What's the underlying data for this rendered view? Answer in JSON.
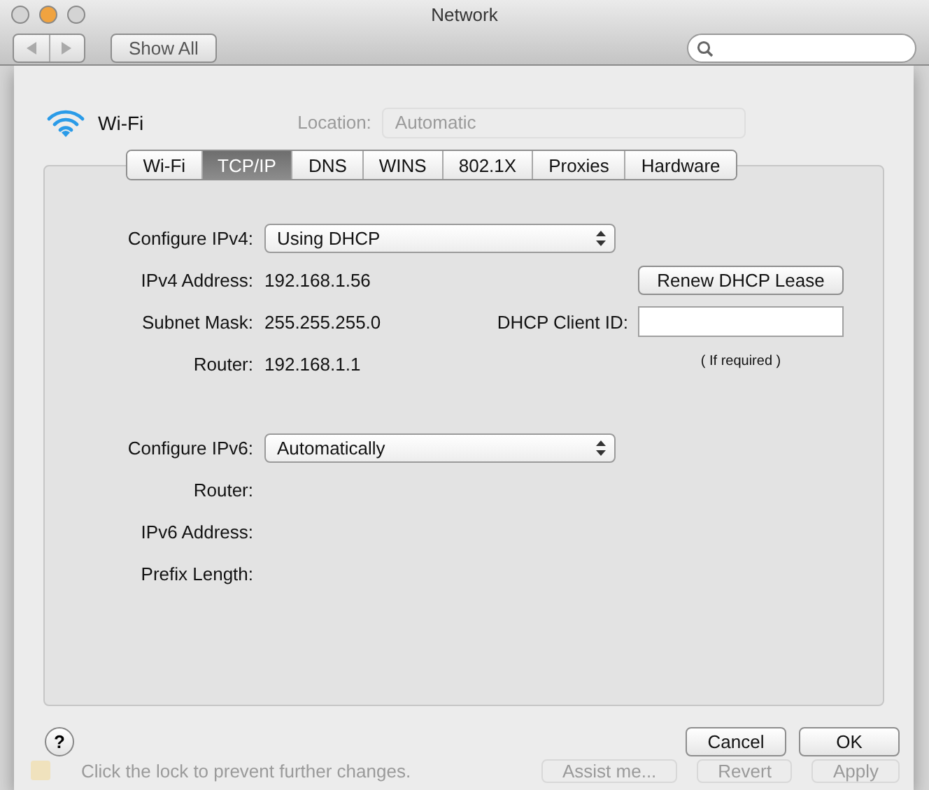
{
  "window": {
    "title": "Network"
  },
  "toolbar": {
    "show_all_button": "Show All"
  },
  "header": {
    "service": "Wi-Fi",
    "location_label": "Location:",
    "location_value": "Automatic"
  },
  "tabs": [
    {
      "label": "Wi-Fi",
      "selected": false
    },
    {
      "label": "TCP/IP",
      "selected": true
    },
    {
      "label": "DNS",
      "selected": false
    },
    {
      "label": "WINS",
      "selected": false
    },
    {
      "label": "802.1X",
      "selected": false
    },
    {
      "label": "Proxies",
      "selected": false
    },
    {
      "label": "Hardware",
      "selected": false
    }
  ],
  "ipv4": {
    "configure_label": "Configure IPv4:",
    "configure_value": "Using DHCP",
    "rows": [
      {
        "label": "IPv4 Address:",
        "value": "192.168.1.56"
      },
      {
        "label": "Subnet Mask:",
        "value": "255.255.255.0"
      },
      {
        "label": "Router:",
        "value": "192.168.1.1"
      }
    ],
    "renew_button": "Renew DHCP Lease",
    "client_id_label": "DHCP Client ID:",
    "client_id_hint": "( If required )"
  },
  "ipv6": {
    "configure_label": "Configure IPv6:",
    "configure_value": "Automatically",
    "rows": [
      {
        "label": "Router:"
      },
      {
        "label": "IPv6 Address:"
      },
      {
        "label": "Prefix Length:"
      }
    ]
  },
  "buttons": {
    "help": "?",
    "cancel": "Cancel",
    "ok": "OK"
  },
  "background_bar": {
    "lock_text": "Click the lock to prevent further changes.",
    "buttons": [
      "Assist me...",
      "Revert",
      "Apply"
    ]
  }
}
